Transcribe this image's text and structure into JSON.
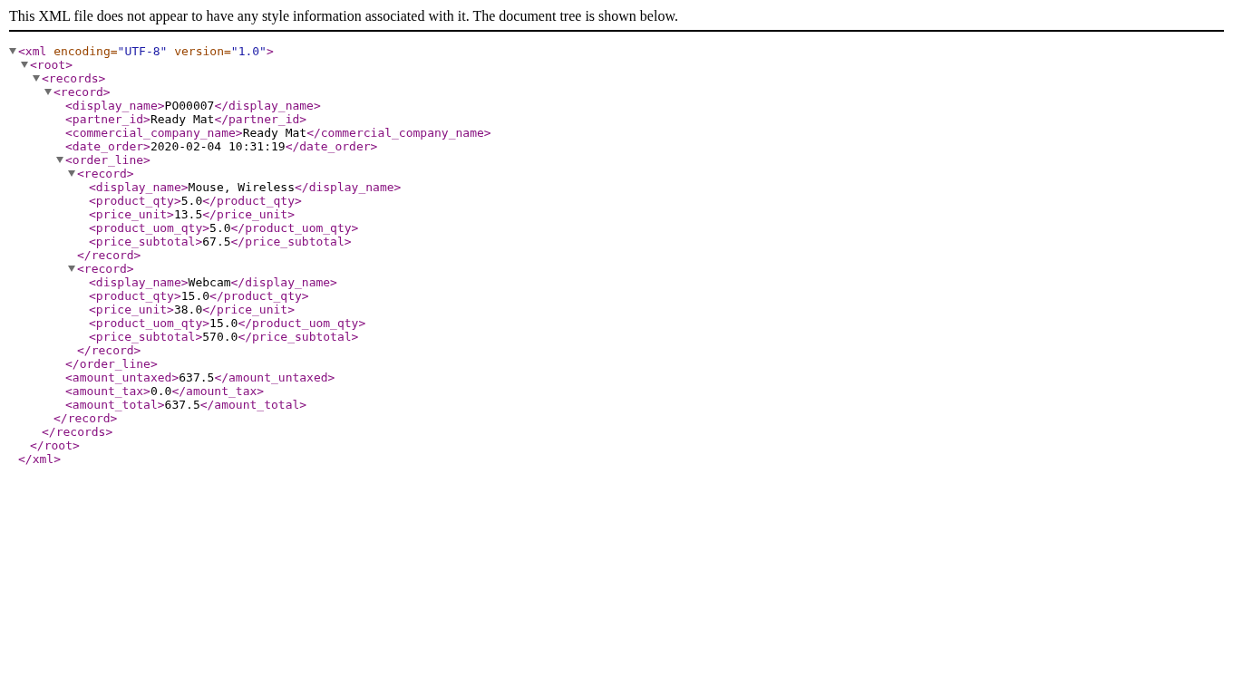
{
  "notice": "This XML file does not appear to have any style information associated with it. The document tree is shown below.",
  "tree": {
    "open": "<xml",
    "attributes": [
      {
        "name": "encoding=",
        "value": "\"UTF-8\""
      },
      {
        "name": "version=",
        "value": "\"1.0\""
      }
    ],
    "open_end": ">",
    "close": "</xml>",
    "expanded": true,
    "children": [
      {
        "open": "<root>",
        "close": "</root>",
        "expanded": true,
        "children": [
          {
            "open": "<records>",
            "close": "</records>",
            "expanded": true,
            "children": [
              {
                "open": "<record>",
                "close": "</record>",
                "expanded": true,
                "children": [
                  {
                    "open": "<display_name>",
                    "text": "PO00007",
                    "close": "</display_name>"
                  },
                  {
                    "open": "<partner_id>",
                    "text": "Ready Mat",
                    "close": "</partner_id>"
                  },
                  {
                    "open": "<commercial_company_name>",
                    "text": "Ready Mat",
                    "close": "</commercial_company_name>"
                  },
                  {
                    "open": "<date_order>",
                    "text": "2020-02-04 10:31:19",
                    "close": "</date_order>"
                  },
                  {
                    "open": "<order_line>",
                    "close": "</order_line>",
                    "expanded": true,
                    "children": [
                      {
                        "open": "<record>",
                        "close": "</record>",
                        "expanded": true,
                        "children": [
                          {
                            "open": "<display_name>",
                            "text": "Mouse, Wireless",
                            "close": "</display_name>"
                          },
                          {
                            "open": "<product_qty>",
                            "text": "5.0",
                            "close": "</product_qty>"
                          },
                          {
                            "open": "<price_unit>",
                            "text": "13.5",
                            "close": "</price_unit>"
                          },
                          {
                            "open": "<product_uom_qty>",
                            "text": "5.0",
                            "close": "</product_uom_qty>"
                          },
                          {
                            "open": "<price_subtotal>",
                            "text": "67.5",
                            "close": "</price_subtotal>"
                          }
                        ]
                      },
                      {
                        "open": "<record>",
                        "close": "</record>",
                        "expanded": true,
                        "children": [
                          {
                            "open": "<display_name>",
                            "text": "Webcam",
                            "close": "</display_name>"
                          },
                          {
                            "open": "<product_qty>",
                            "text": "15.0",
                            "close": "</product_qty>"
                          },
                          {
                            "open": "<price_unit>",
                            "text": "38.0",
                            "close": "</price_unit>"
                          },
                          {
                            "open": "<product_uom_qty>",
                            "text": "15.0",
                            "close": "</product_uom_qty>"
                          },
                          {
                            "open": "<price_subtotal>",
                            "text": "570.0",
                            "close": "</price_subtotal>"
                          }
                        ]
                      }
                    ]
                  },
                  {
                    "open": "<amount_untaxed>",
                    "text": "637.5",
                    "close": "</amount_untaxed>"
                  },
                  {
                    "open": "<amount_tax>",
                    "text": "0.0",
                    "close": "</amount_tax>"
                  },
                  {
                    "open": "<amount_total>",
                    "text": "637.5",
                    "close": "</amount_total>"
                  }
                ]
              }
            ]
          }
        ]
      }
    ]
  }
}
